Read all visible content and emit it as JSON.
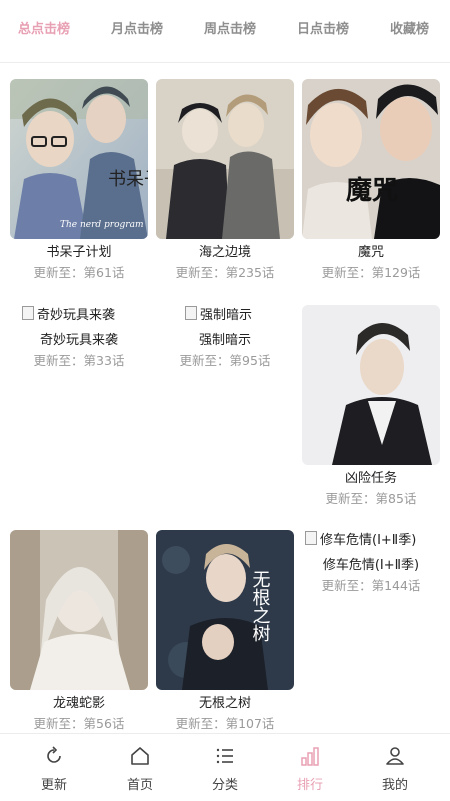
{
  "tabs": [
    {
      "label": "总点击榜",
      "active": true
    },
    {
      "label": "月点击榜",
      "active": false
    },
    {
      "label": "周点击榜",
      "active": false
    },
    {
      "label": "日点击榜",
      "active": false
    },
    {
      "label": "收藏榜",
      "active": false
    }
  ],
  "comics": [
    {
      "title": "书呆子计划",
      "update": "更新至：第61话",
      "has_cover": true,
      "cover_text": "书呆子计划",
      "cover_subtext": "The nerd program"
    },
    {
      "title": "海之边境",
      "update": "更新至：第235话",
      "has_cover": true
    },
    {
      "title": "魔咒",
      "update": "更新至：第129话",
      "has_cover": true,
      "cover_text": "魔咒"
    },
    {
      "title": "奇妙玩具来袭",
      "update": "更新至：第33话",
      "has_cover": false,
      "alt": "奇妙玩具来袭"
    },
    {
      "title": "强制暗示",
      "update": "更新至：第95话",
      "has_cover": false,
      "alt": "强制暗示"
    },
    {
      "title": "凶险任务",
      "update": "更新至：第85话",
      "has_cover": true
    },
    {
      "title": "龙魂蛇影",
      "update": "更新至：第56话",
      "has_cover": true
    },
    {
      "title": "无根之树",
      "update": "更新至：第107话",
      "has_cover": true,
      "cover_text": "无根之树"
    },
    {
      "title": "修车危情(Ⅰ+Ⅱ季)",
      "update": "更新至：第144话",
      "has_cover": false,
      "alt": "修车危情(Ⅰ+Ⅱ季)"
    }
  ],
  "bottom_nav": [
    {
      "label": "更新",
      "icon": "refresh-icon",
      "active": false
    },
    {
      "label": "首页",
      "icon": "home-icon",
      "active": false
    },
    {
      "label": "分类",
      "icon": "list-icon",
      "active": false
    },
    {
      "label": "排行",
      "icon": "bar-chart-icon",
      "active": true
    },
    {
      "label": "我的",
      "icon": "user-icon",
      "active": false
    }
  ],
  "colors": {
    "accent": "#e8a0b4",
    "inactive": "#8e8e8e",
    "muted": "#9a9a9a"
  }
}
